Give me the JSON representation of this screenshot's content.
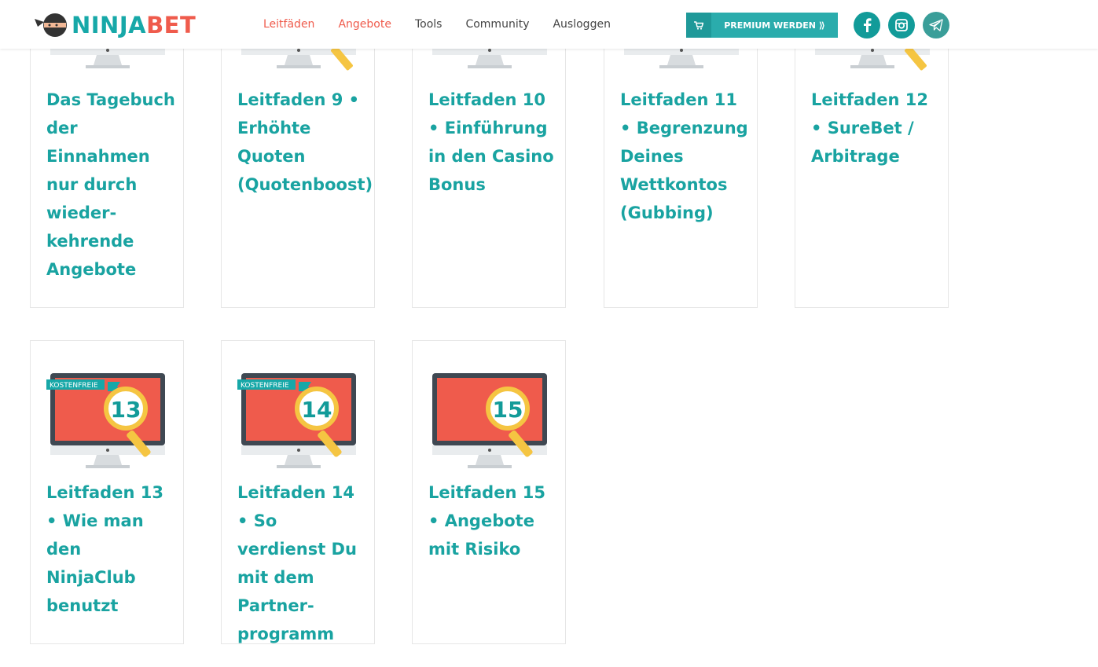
{
  "header": {
    "logo_part1": "NINJA",
    "logo_part2": "BET",
    "nav": [
      "Leitfäden",
      "Angebote",
      "Tools",
      "Community",
      "Ausloggen"
    ],
    "premium_label": "PREMIUM WERDEN ⟫",
    "social": [
      "facebook-icon",
      "instagram-icon",
      "telegram-icon"
    ]
  },
  "colors": {
    "teal": "#19a3a1",
    "coral": "#ef5b4c",
    "screen_red": "#ef5b4c",
    "magnifier_yellow": "#f5c542"
  },
  "cards": [
    {
      "title": "Das Tagebuch der Einnahmen nur durch wieder-kehrende Angebote"
    },
    {
      "title": "Leitfaden 9 • Erhöhte Quoten (Quotenboost)"
    },
    {
      "title": "Leitfaden 10 • Einführung in den Casino Bonus"
    },
    {
      "title": "Leitfaden 11 • Begrenzung Deines Wettkontos (Gubbing)"
    },
    {
      "title": "Leitfaden 12 • SureBet / Arbitrage"
    },
    {
      "title": "Leitfaden 13 • Wie man den NinjaClub benutzt",
      "badge": "KOSTENFREIE",
      "number": "13"
    },
    {
      "title": "Leitfaden 14 • So verdienst Du mit dem Partner-programm",
      "badge": "KOSTENFREIE",
      "number": "14"
    },
    {
      "title": "Leitfaden 15 • Angebote mit Risiko",
      "number": "15"
    }
  ]
}
